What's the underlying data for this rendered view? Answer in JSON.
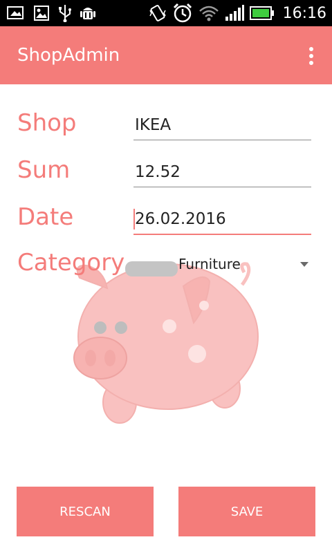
{
  "status_bar": {
    "time": "16:16",
    "icons": [
      "gallery-icon",
      "image-icon",
      "usb-icon",
      "android-debug-icon",
      "vibrate-icon",
      "alarm-icon",
      "wifi-icon",
      "signal-icon",
      "battery-icon"
    ]
  },
  "app_bar": {
    "title": "ShopAdmin",
    "menu_icon": "overflow-menu-icon"
  },
  "form": {
    "shop": {
      "label": "Shop",
      "value": "IKEA"
    },
    "sum": {
      "label": "Sum",
      "value": "12.52"
    },
    "date": {
      "label": "Date",
      "value": "26.02.2016"
    },
    "category": {
      "label": "Category",
      "selected": "Furniture"
    }
  },
  "buttons": {
    "rescan": "RESCAN",
    "save": "SAVE"
  },
  "colors": {
    "accent": "#F47C7A",
    "pig": "#F9C1C0"
  }
}
